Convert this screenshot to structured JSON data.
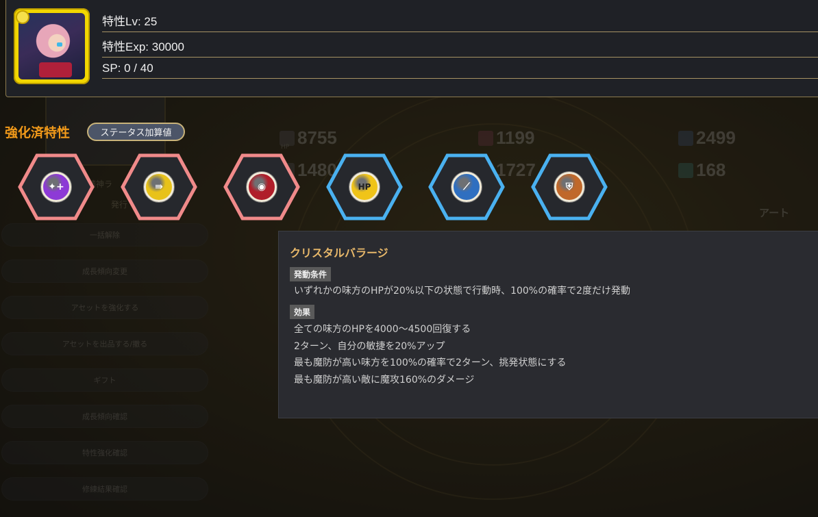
{
  "header": {
    "trait_level": "特性Lv: 25",
    "trait_exp": "特性Exp: 30000",
    "sp": "SP: 0 / 40"
  },
  "enhanced": {
    "title": "強化済特性",
    "status_button": "ステータス加算値"
  },
  "traits": [
    {
      "icon": "crystal-plus-icon",
      "color": "#8d3ad6",
      "frame": "#f08a8a",
      "glyph": "✦+"
    },
    {
      "icon": "red-arrow-icon",
      "color": "#e8c21a",
      "frame": "#f08a8a",
      "glyph": "⇛"
    },
    {
      "icon": "shield-emblem-icon",
      "color": "#b01e2a",
      "frame": "#f08a8a",
      "glyph": "◉"
    },
    {
      "icon": "hp-icon",
      "color": "#f0c419",
      "frame": "#4ab1f0",
      "glyph": "HP"
    },
    {
      "icon": "wand-icon",
      "color": "#2f6fc0",
      "frame": "#4ab1f0",
      "glyph": "⟋"
    },
    {
      "icon": "armor-shield-icon",
      "color": "#c0682a",
      "frame": "#4ab1f0",
      "glyph": "⛨"
    }
  ],
  "background": {
    "stats": {
      "hp": "8755",
      "hp_label": "HP",
      "atk": "1199",
      "def": "2499",
      "stat4": "1480",
      "stat5": "1727",
      "stat6": "168"
    },
    "tabs": {
      "art": "アート"
    },
    "side_buttons": [
      "一括解除",
      "成長傾向変更",
      "アセットを強化する",
      "アセットを出品する/撤る",
      "ギフト",
      "成長傾向確認",
      "特性強化確認",
      "修練結果確認"
    ],
    "card_labels": {
      "top": "精神ラ",
      "sub": "発行"
    }
  },
  "skill": {
    "name": "クリスタルバラージ",
    "condition_label": "発動条件",
    "condition": "いずれかの味方のHPが20%以下の状態で行動時、100%の確率で2度だけ発動",
    "effect_label": "効果",
    "effects": [
      "全ての味方のHPを4000〜4500回復する",
      "2ターン、自分の敏捷を20%アップ",
      "最も魔防が高い味方を100%の確率で2ターン、挑発状態にする",
      "最も魔防が高い敵に魔攻160%のダメージ"
    ]
  }
}
